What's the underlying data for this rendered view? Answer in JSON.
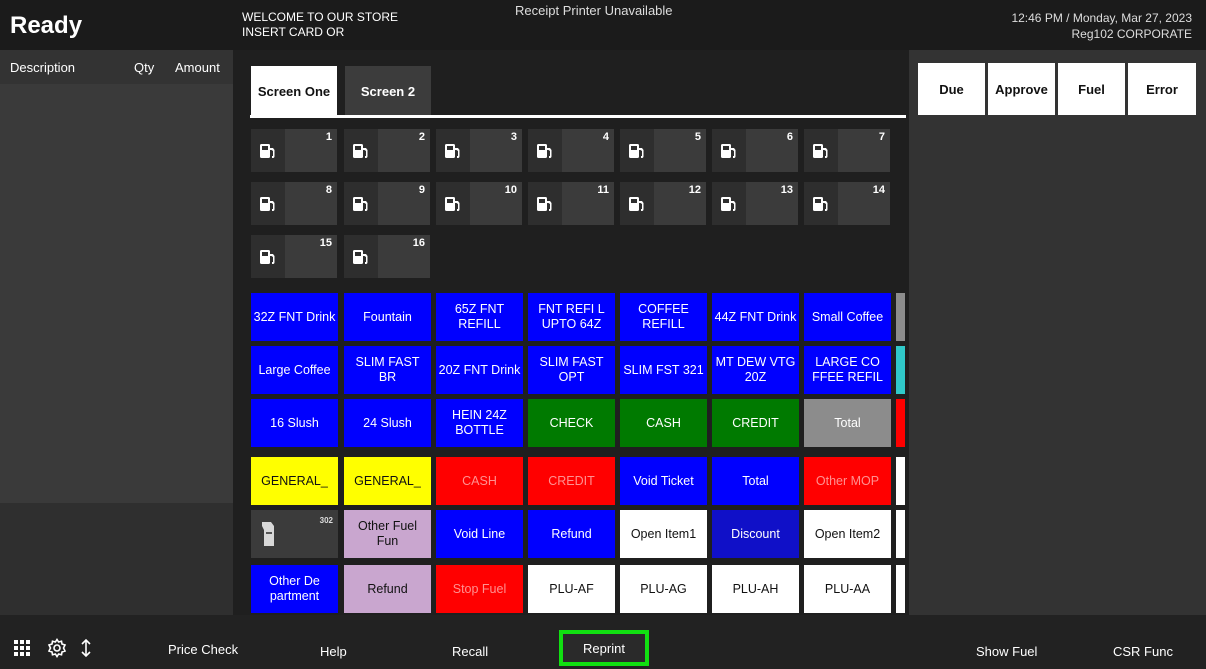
{
  "header": {
    "status": "Ready",
    "welcome_line1": "WELCOME TO OUR STORE",
    "welcome_line2": "INSERT CARD OR",
    "printer_message": "Receipt Printer Unavailable",
    "datetime": "12:46 PM / Monday, Mar 27, 2023",
    "register": "Reg102  CORPORATE"
  },
  "transaction": {
    "columns": [
      "Description",
      "Qty",
      "Amount"
    ]
  },
  "tabs": [
    {
      "label": "Screen One",
      "active": true
    },
    {
      "label": "Screen 2",
      "active": false
    }
  ],
  "pumps": [
    "1",
    "2",
    "3",
    "4",
    "5",
    "6",
    "7",
    "8",
    "9",
    "10",
    "11",
    "12",
    "13",
    "14",
    "15",
    "16"
  ],
  "device_badge": "302",
  "keys": [
    [
      "32Z FNT Drink",
      "Fountain",
      "65Z FNT REFILL",
      "FNT REFI L UPTO 64Z",
      "COFFEE REFILL",
      "44Z FNT Drink",
      "Small Coffee"
    ],
    [
      "Large Coffee",
      "SLIM FAST BR",
      "20Z FNT Drink",
      "SLIM FAST OPT",
      "SLIM FST 321",
      "MT DEW VTG 20Z",
      "LARGE CO FFEE REFIL"
    ],
    [
      "16 Slush",
      "24 Slush",
      "HEIN 24Z BOTTLE",
      "CHECK",
      "CASH",
      "CREDIT",
      "Total"
    ],
    [
      "GENERAL_",
      "GENERAL_",
      "CASH",
      "CREDIT",
      "Void Ticket",
      "Total",
      "Other MOP"
    ],
    [
      "",
      "Other Fuel Fun",
      "Void Line",
      "Refund",
      "Open Item1",
      "Discount",
      "Open Item2"
    ],
    [
      "Other De partment",
      "Refund",
      "Stop Fuel",
      "PLU-AF",
      "PLU-AG",
      "PLU-AH",
      "PLU-AA"
    ]
  ],
  "colors": {
    "blue": "#0000ff",
    "green": "#007a00",
    "gray": "#8c8c8c",
    "yellow": "#ffff00",
    "red": "#ff0000",
    "lilac": "#c9a6cf",
    "white": "#ffffff",
    "teal": "#30c9c9",
    "highlight": "#11e011"
  },
  "right_buttons": [
    "Due",
    "Approve",
    "Fuel",
    "Error"
  ],
  "footer": {
    "icons": [
      "grid-icon",
      "gear-icon",
      "up-down-arrow-icon"
    ],
    "price_check": "Price Check",
    "help": "Help",
    "recall": "Recall",
    "reprint": "Reprint",
    "show_fuel": "Show Fuel",
    "csr_func": "CSR Func"
  }
}
